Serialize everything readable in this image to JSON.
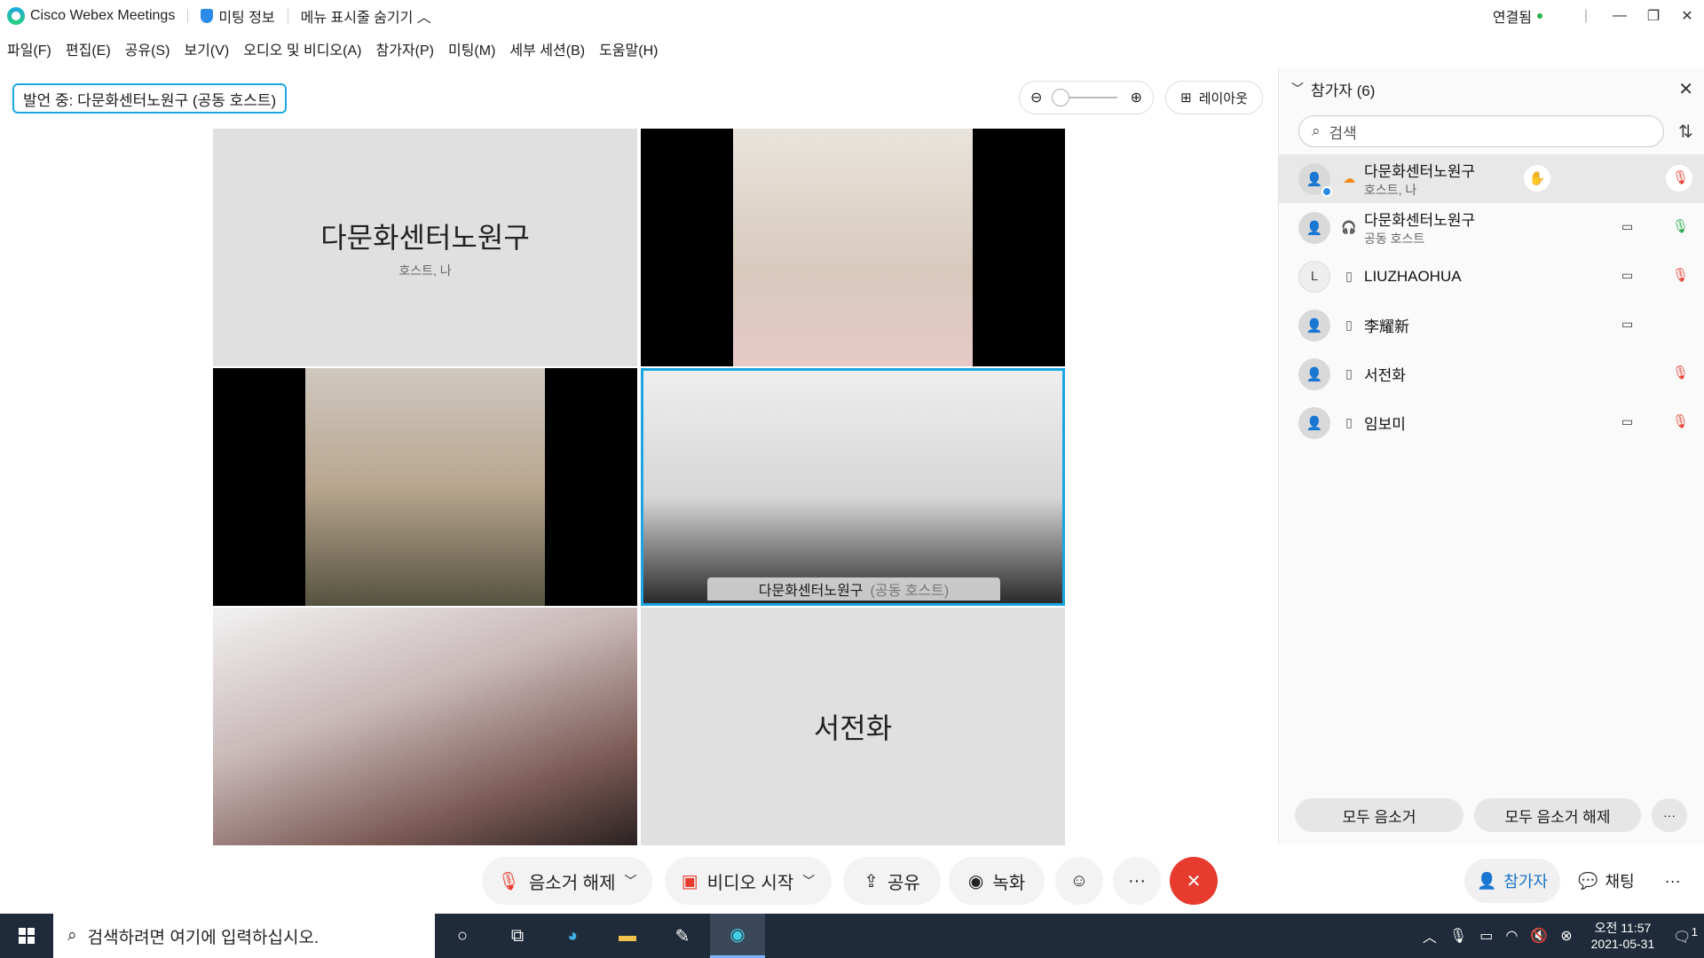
{
  "app": {
    "title": "Cisco Webex Meetings",
    "meeting_info": "미팅 정보",
    "hide_menu": "메뉴 표시줄 숨기기",
    "connection_status": "연결됨"
  },
  "menu": [
    "파일(F)",
    "편집(E)",
    "공유(S)",
    "보기(V)",
    "오디오 및 비디오(A)",
    "참가자(P)",
    "미팅(M)",
    "세부 세션(B)",
    "도움말(H)"
  ],
  "stage": {
    "speaking_label": "발언 중: 다문화센터노원구 (공동 호스트)",
    "layout_label": "레이아웃",
    "tiles": [
      {
        "name": "다문화센터노원구",
        "role": "호스트, 나"
      },
      {
        "name": "다문화센터노원구",
        "role": "(공동 호스트)"
      },
      {
        "name": "서전화"
      }
    ]
  },
  "controls": {
    "unmute": "음소거 해제",
    "start_video": "비디오 시작",
    "share": "공유",
    "record": "녹화"
  },
  "participants_panel": {
    "title": "참가자 (6)",
    "search_placeholder": "검색",
    "participants": [
      {
        "name": "다문화센터노원구",
        "role": "호스트, 나"
      },
      {
        "name": "다문화센터노원구",
        "role": "공동 호스트"
      },
      {
        "name": "LIUZHAOHUA",
        "initial": "L"
      },
      {
        "name": "李耀新"
      },
      {
        "name": "서전화"
      },
      {
        "name": "임보미"
      }
    ],
    "mute_all": "모두 음소거",
    "unmute_all": "모두 음소거 해제",
    "tab_participants": "참가자",
    "tab_chat": "채팅"
  },
  "taskbar": {
    "search_placeholder": "검색하려면 여기에 입력하십시오.",
    "time": "오전 11:57",
    "date": "2021-05-31",
    "notification_count": "1"
  }
}
